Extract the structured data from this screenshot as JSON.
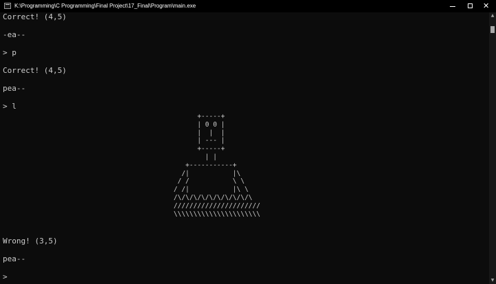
{
  "window": {
    "title": "K:\\Programming\\C Programming\\Final Project\\17_Final\\Program\\main.exe",
    "icon": "console-app-icon",
    "controls": {
      "minimize_icon": "minimize-icon",
      "maximize_icon": "maximize-icon",
      "close_glyph": "✕"
    }
  },
  "console": {
    "lines": [
      "Correct! (4,5)",
      "-ea--",
      "> p",
      "Correct! (4,5)",
      "pea--",
      "> l",
      "Wrong! (3,5)",
      "pea--",
      ">"
    ],
    "hangman_art": "      +-----+\n      | 0 0 |\n      |  |  |\n      | --- |\n      +-----+\n        | |\n   +-----------+\n  /|           |\\\n / /           \\ \\\n/ /|           |\\ \\\n/\\/\\/\\/\\/\\/\\/\\/\\/\\/\\\n//////////////////////\n\\\\\\\\\\\\\\\\\\\\\\\\\\\\\\\\\\\\\\\\\\\\"
  },
  "scrollbar": {
    "up_arrow": "▲",
    "down_arrow": "▼"
  },
  "colors": {
    "background": "#0c0c0c",
    "text": "#cccccc",
    "titlebar": "#000000"
  }
}
